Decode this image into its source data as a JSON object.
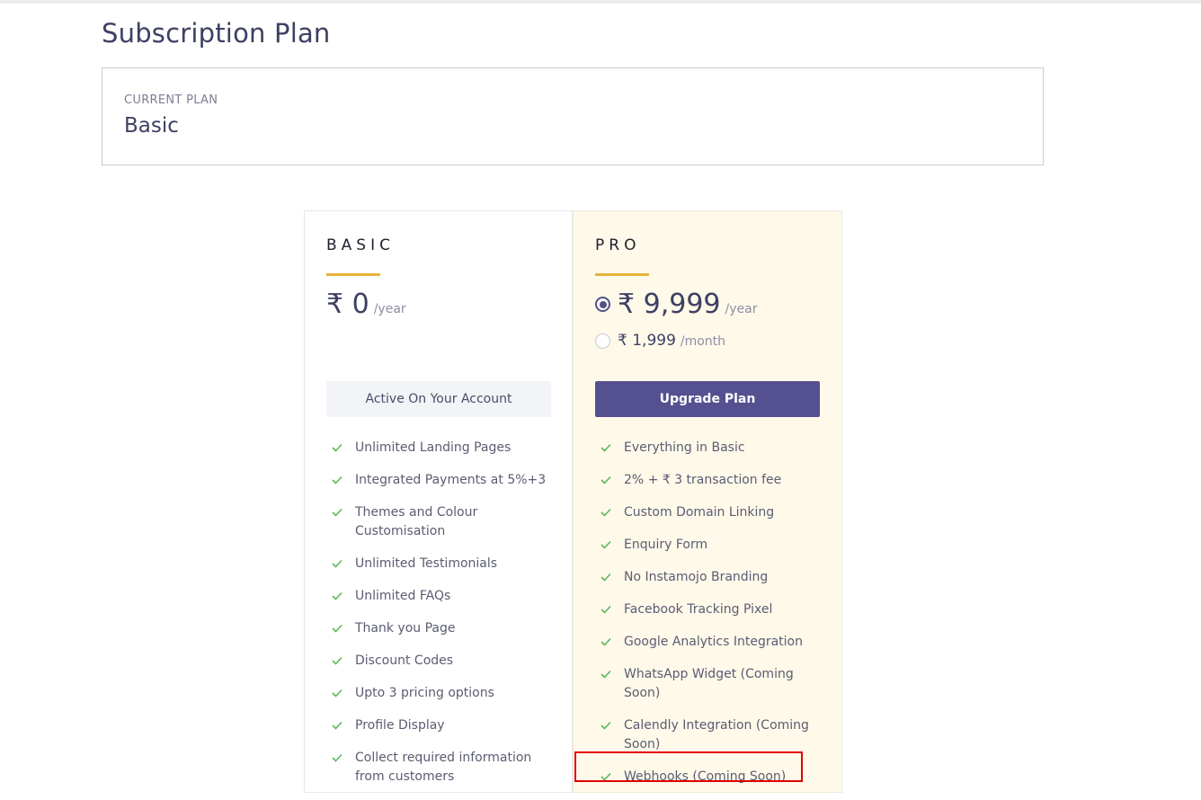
{
  "page": {
    "title": "Subscription Plan"
  },
  "current_plan": {
    "label": "CURRENT PLAN",
    "value": "Basic"
  },
  "plans": {
    "basic": {
      "name": "BASIC",
      "price": "₹ 0",
      "period": "/year",
      "button_label": "Active On Your Account",
      "features": [
        "Unlimited Landing Pages",
        "Integrated Payments at 5%+3",
        "Themes and Colour Customisation",
        "Unlimited Testimonials",
        "Unlimited FAQs",
        "Thank you Page",
        "Discount Codes",
        "Upto 3 pricing options",
        "Profile Display",
        "Collect required information from customers"
      ]
    },
    "pro": {
      "name": "PRO",
      "yearly_price": "₹ 9,999",
      "yearly_period": "/year",
      "yearly_selected": true,
      "monthly_price": "₹ 1,999",
      "monthly_period": "/month",
      "monthly_selected": false,
      "button_label": "Upgrade Plan",
      "features": [
        "Everything in Basic",
        "2% + ₹ 3 transaction fee",
        "Custom Domain Linking",
        "Enquiry Form",
        "No Instamojo Branding",
        "Facebook Tracking Pixel",
        "Google Analytics Integration",
        "WhatsApp Widget (Coming Soon)",
        "Calendly Integration (Coming Soon)",
        "Webhooks (Coming Soon)"
      ]
    }
  },
  "colors": {
    "accent": "#555090",
    "underline": "#e8b33a",
    "check": "#5cb85c",
    "pro_background": "#fff9ea",
    "highlight": "#e00000"
  },
  "icons": {
    "feature_check": "check-icon",
    "price_option": "radio-icon"
  }
}
